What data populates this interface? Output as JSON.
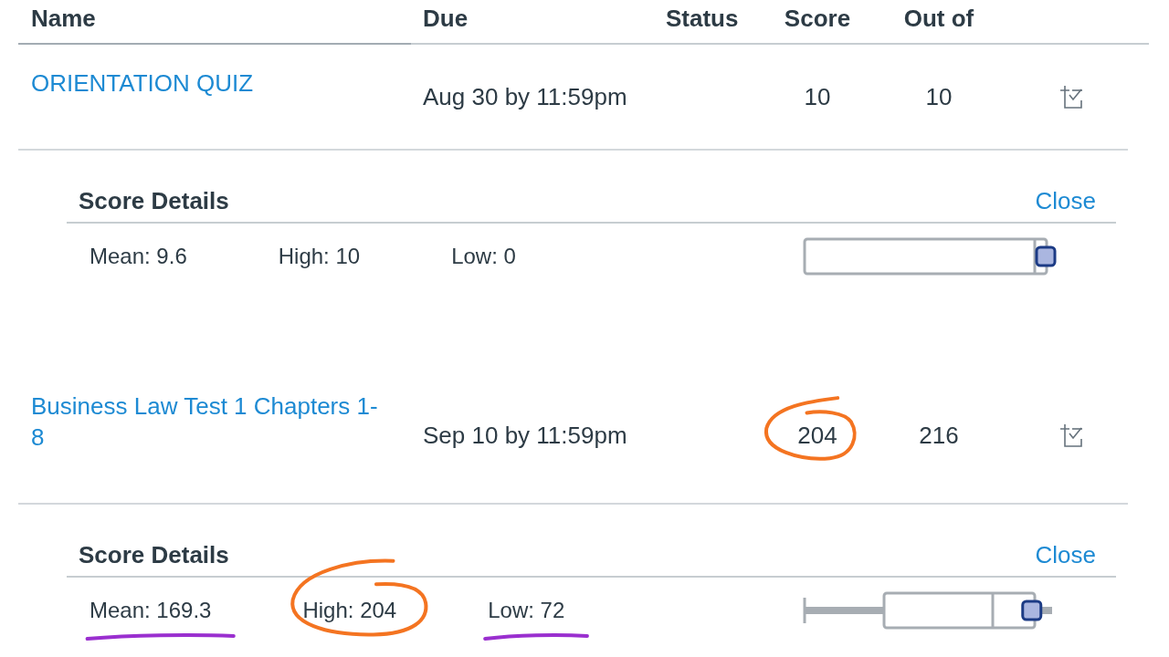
{
  "table": {
    "columns": [
      "Name",
      "Due",
      "Status",
      "Score",
      "Out of"
    ]
  },
  "rows": [
    {
      "name": "ORIENTATION QUIZ",
      "due": "Aug 30 by 11:59pm",
      "score": "10",
      "score_circled": false,
      "out_of": "10",
      "details": {
        "title": "Score Details",
        "close": "Close",
        "stats": [
          {
            "text": "Mean: 9.6",
            "circled": false,
            "underlined": false
          },
          {
            "text": "High: 10",
            "circled": false,
            "underlined": false
          },
          {
            "text": "Low: 0",
            "circled": false,
            "underlined": false
          }
        ],
        "box_plot": {
          "level": 1
        }
      }
    },
    {
      "name": "Business Law Test 1 Chapters 1-8",
      "due": "Sep 10 by 11:59pm",
      "score": "204",
      "score_circled": true,
      "out_of": "216",
      "details": {
        "title": "Score Details",
        "close": "Close",
        "stats": [
          {
            "text": "Mean: 169.3",
            "circled": false,
            "underlined": true
          },
          {
            "text": "High: 204",
            "circled": true,
            "underlined": false
          },
          {
            "text": "Low: 72",
            "circled": false,
            "underlined": true
          }
        ],
        "box_plot": {
          "level": 0.94
        }
      }
    }
  ]
}
